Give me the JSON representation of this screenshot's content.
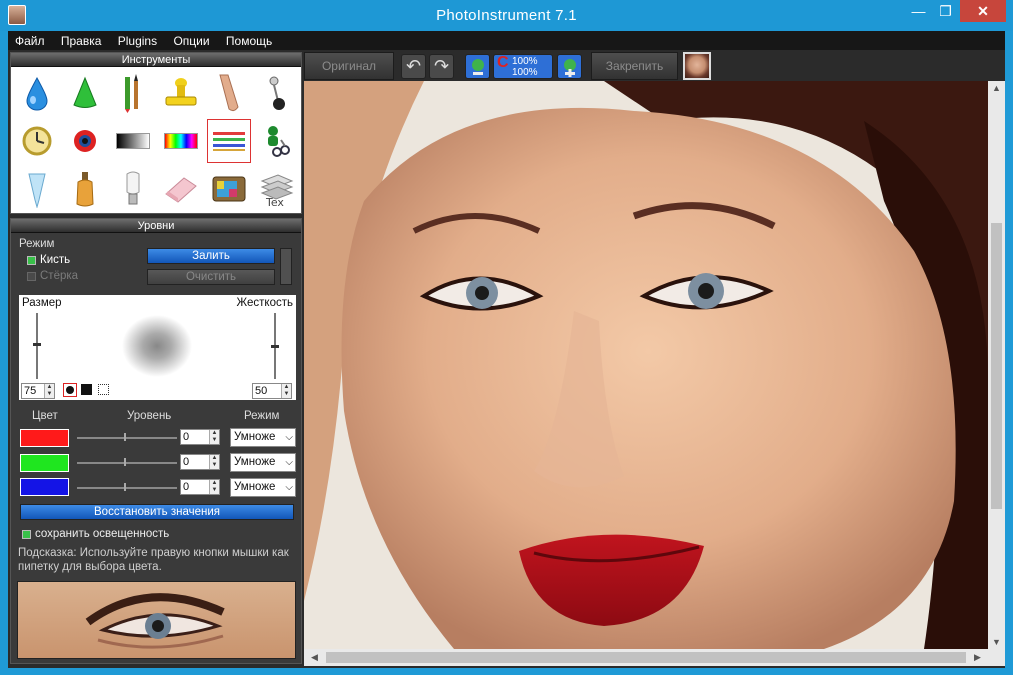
{
  "window": {
    "title": "PhotoInstrument 7.1",
    "min": "—",
    "max": "❐",
    "close": "✕"
  },
  "menu": [
    "Файл",
    "Правка",
    "Plugins",
    "Опции",
    "Помощь"
  ],
  "tools_panel": {
    "title": "Инструменты",
    "selected": "color-stripes-tool",
    "items": [
      "drop-tool",
      "cone-tool",
      "brush-pencil-tool",
      "stamp-tool",
      "finger-tool",
      "pin-tool",
      "clock-tool",
      "eye-tool",
      "gradient-tool",
      "spectrum-tool",
      "color-stripes-tool",
      "clone-scissors-tool",
      "tube-tool",
      "bottle-tool",
      "lamp-tool",
      "eraser-tool",
      "tv-tool",
      "text-tool"
    ]
  },
  "levels_panel": {
    "title": "Уровни",
    "mode_label": "Режим",
    "brush_label": "Кисть",
    "eraser_label": "Стёрка",
    "fill_button": "Залить",
    "clear_button": "Очистить",
    "size_label": "Размер",
    "hardness_label": "Жесткость",
    "size_value": "75",
    "hardness_value": "50",
    "col_color": "Цвет",
    "col_level": "Уровень",
    "col_mode": "Режим",
    "rows": [
      {
        "color": "#ff1a1a",
        "value": "0",
        "mode": "Умноже"
      },
      {
        "color": "#1fe61f",
        "value": "0",
        "mode": "Умноже"
      },
      {
        "color": "#1414e6",
        "value": "0",
        "mode": "Умноже"
      }
    ],
    "restore_button": "Восстановить значения",
    "keep_light_label": "сохранить освещенность",
    "hint": "Подсказка: Используйте правую кнопки мышки как пипетку для выбора цвета."
  },
  "toolbar": {
    "original_button": "Оригинал",
    "zoom_label_top": "100%",
    "zoom_label_bottom": "100%",
    "pin_button": "Закрепить"
  }
}
